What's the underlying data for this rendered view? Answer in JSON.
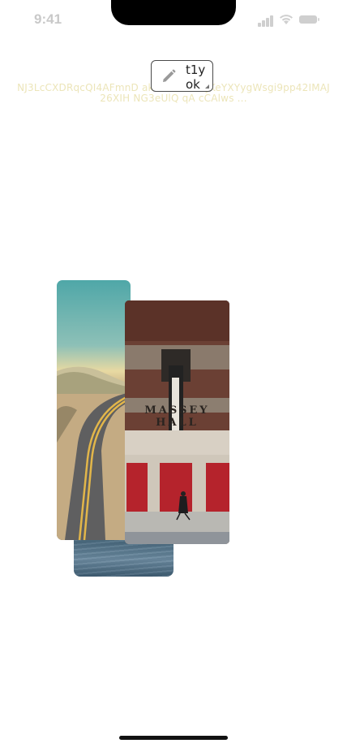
{
  "status_bar": {
    "time": "9:41"
  },
  "watermark": {
    "line1": "NJ3LcCXDRqcQI4AFmnD akSCBkvbD8JKeYXYygWsgi9pp42IMAJ",
    "line2": "26XIH NG3eUlQ qA cCAlws ..."
  },
  "chip": {
    "icon": "pencil-icon",
    "label_line1": "t1y",
    "label_line2": "ok"
  },
  "photo_stack": {
    "cards": [
      {
        "subject": "ocean-water"
      },
      {
        "subject": "desert-road"
      },
      {
        "subject": "massey-hall-building",
        "sign_text": "MASSEY HALL"
      }
    ]
  },
  "colors": {
    "background": "#ffffff",
    "watermark": "#ece5b9",
    "door_red": "#b5232c",
    "home_indicator": "#111111"
  }
}
